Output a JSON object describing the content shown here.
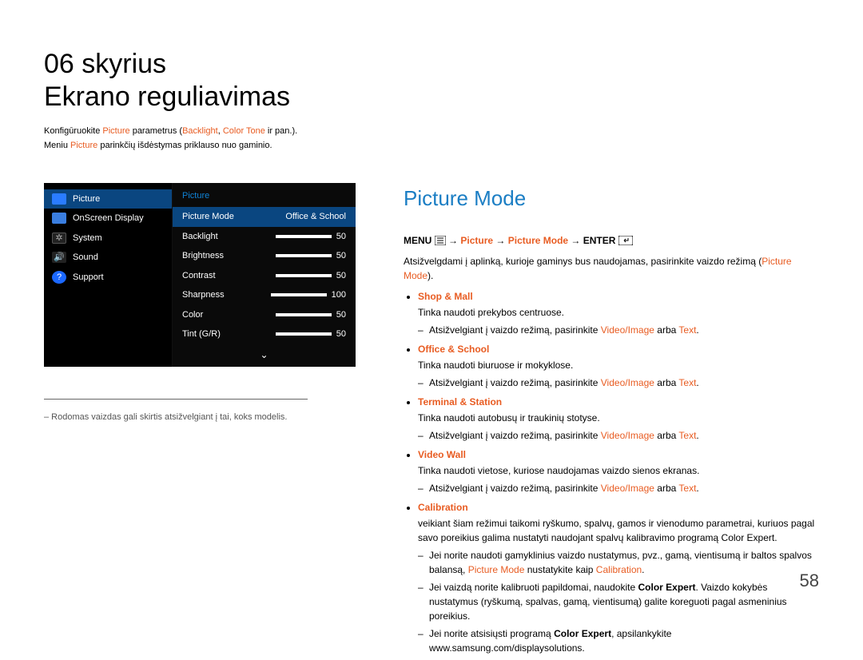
{
  "chapter": {
    "number_label": "06 skyrius",
    "title": "Ekrano reguliavimas"
  },
  "intro": {
    "prefix": "Konfigūruokite ",
    "picture": "Picture",
    "mid": " parametrus (",
    "backlight": "Backlight",
    "sep": ", ",
    "colortone": "Color Tone",
    "suffix": " ir pan.)."
  },
  "intro2": {
    "prefix": "Meniu ",
    "picture": "Picture",
    "suffix": " parinkčių išdėstymas priklauso nuo gaminio."
  },
  "osd": {
    "left": {
      "items": [
        {
          "label": "Picture"
        },
        {
          "label": "OnScreen Display"
        },
        {
          "label": "System"
        },
        {
          "label": "Sound"
        },
        {
          "label": "Support"
        }
      ]
    },
    "right": {
      "header": "Picture",
      "rows": [
        {
          "label": "Picture Mode",
          "value": "Office & School"
        },
        {
          "label": "Backlight",
          "value": "50"
        },
        {
          "label": "Brightness",
          "value": "50"
        },
        {
          "label": "Contrast",
          "value": "50"
        },
        {
          "label": "Sharpness",
          "value": "100"
        },
        {
          "label": "Color",
          "value": "50"
        },
        {
          "label": "Tint (G/R)",
          "value": "50"
        }
      ]
    }
  },
  "footnote": "–  Rodomas vaizdas gali skirtis atsižvelgiant į tai, koks modelis.",
  "section_title": "Picture Mode",
  "path": {
    "menu": "MENU",
    "arrow": " → ",
    "p1": "Picture",
    "p2": "Picture Mode",
    "enter": "ENTER"
  },
  "body_intro": {
    "prefix": "Atsižvelgdami į aplinką, kurioje gaminys bus naudojamas, pasirinkite vaizdo režimą (",
    "pm": "Picture Mode",
    "suffix": ")."
  },
  "sub_line": {
    "prefix": "Atsižvelgiant į vaizdo režimą, pasirinkite ",
    "vi": "Video/Image",
    "mid": " arba ",
    "tx": "Text",
    "suffix": "."
  },
  "modes": [
    {
      "name": "Shop & Mall",
      "desc": "Tinka naudoti prekybos centruose.",
      "has_sub": true
    },
    {
      "name": "Office & School",
      "desc": "Tinka naudoti biuruose ir mokyklose.",
      "has_sub": true
    },
    {
      "name": "Terminal & Station",
      "desc": "Tinka naudoti autobusų ir traukinių stotyse.",
      "has_sub": true
    },
    {
      "name": "Video Wall",
      "desc": "Tinka naudoti vietose, kuriose naudojamas vaizdo sienos ekranas.",
      "has_sub": true
    },
    {
      "name": "Calibration",
      "desc": "veikiant šiam režimui taikomi ryškumo, spalvų, gamos ir vienodumo parametrai, kuriuos pagal savo poreikius galima nustatyti naudojant spalvų kalibravimo programą Color Expert.",
      "has_sub": false
    }
  ],
  "calib_subs": {
    "a_pre": "Jei norite naudoti gamyklinius vaizdo nustatymus, pvz., gamą, vientisumą ir baltos spalvos balansą, ",
    "a_hl1": "Picture Mode",
    "a_mid": " nustatykite kaip ",
    "a_hl2": "Calibration",
    "a_suf": ".",
    "b_pre": "Jei vaizdą norite kalibruoti papildomai, naudokite ",
    "b_ce": "Color Expert",
    "b_suf": ". Vaizdo kokybės nustatymus (ryškumą, spalvas, gamą, vientisumą) galite koreguoti pagal asmeninius poreikius.",
    "c_pre": "Jei norite atsisiųsti programą ",
    "c_ce": "Color Expert",
    "c_suf": ", apsilankykite www.samsung.com/displaysolutions."
  },
  "page_number": "58"
}
